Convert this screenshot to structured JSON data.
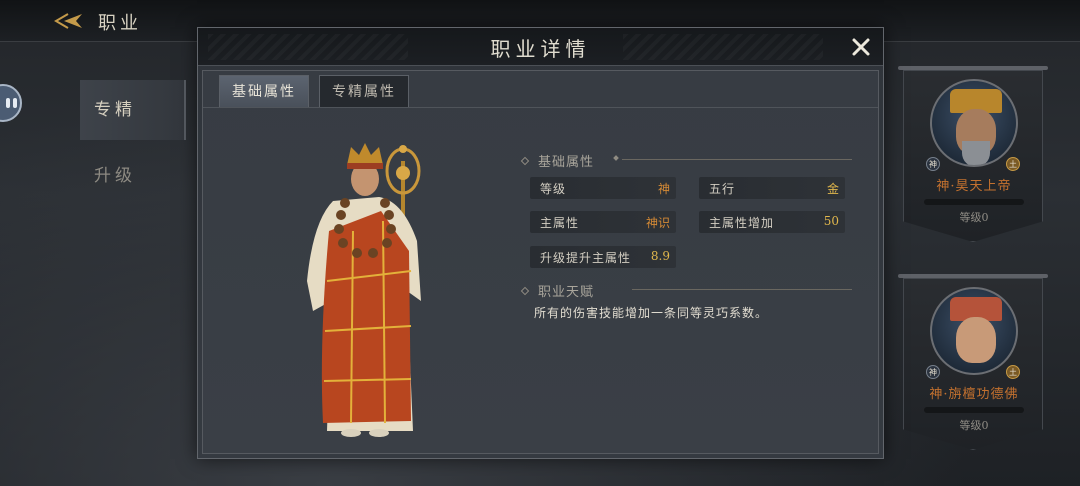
{
  "topbar": {
    "title": "职业"
  },
  "leftnav": {
    "items": [
      {
        "label": "专精",
        "active": true
      },
      {
        "label": "升级",
        "active": false
      }
    ]
  },
  "dialog": {
    "title": "职业详情",
    "tabs": [
      {
        "label": "基础属性",
        "active": true
      },
      {
        "label": "专精属性",
        "active": false
      }
    ],
    "basic_section": {
      "title": "基础属性"
    },
    "attributes": [
      {
        "label": "等级",
        "value": "神"
      },
      {
        "label": "五行",
        "value": "金"
      },
      {
        "label": "主属性",
        "value": "神识"
      },
      {
        "label": "主属性增加",
        "value": "50"
      },
      {
        "label": "升级提升主属性",
        "value": "8.9"
      }
    ],
    "talent_section": {
      "title": "职业天赋",
      "text": "所有的伤害技能增加一条同等灵巧系数。"
    }
  },
  "side_cards": [
    {
      "name": "神·昊天上帝",
      "level": "等级0",
      "badge_left": "神",
      "badge_right": "土"
    },
    {
      "name": "神·旃檀功德佛",
      "level": "等级0",
      "badge_left": "神",
      "badge_right": "土"
    }
  ],
  "colors": {
    "value_orange": "#d58a35",
    "value_gold": "#e1b74c",
    "card_name": "#c3712f"
  }
}
